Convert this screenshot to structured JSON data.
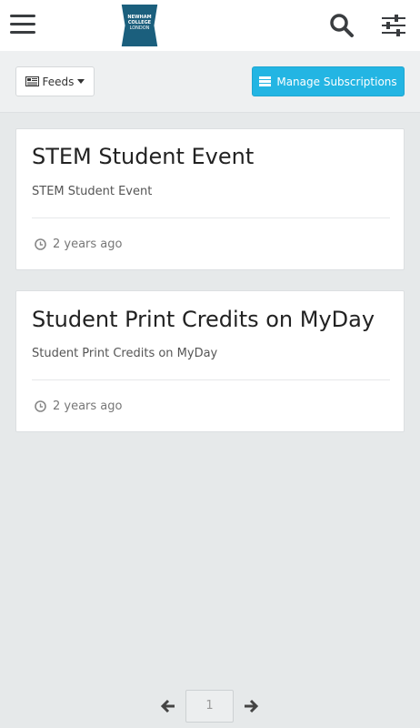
{
  "header": {
    "logo_lines": [
      "NEWHAM",
      "COLLEGE",
      "LONDON"
    ]
  },
  "toolbar": {
    "feeds_label": "Feeds",
    "manage_label": "Manage Subscriptions"
  },
  "feed": {
    "items": [
      {
        "title": "STEM Student Event",
        "description": "STEM Student Event",
        "time": "2 years ago"
      },
      {
        "title": "Student Print Credits on MyDay",
        "description": "Student Print Credits on MyDay",
        "time": "2 years ago"
      }
    ]
  },
  "pagination": {
    "current_page": "1"
  },
  "colors": {
    "accent": "#23b5e3",
    "logo": "#1b5f7d",
    "background": "#e6e9ea"
  },
  "icons": [
    "menu-icon",
    "search-icon",
    "filter-sliders-icon",
    "newspaper-icon",
    "caret-down-icon",
    "list-icon",
    "clock-icon",
    "arrow-left-icon",
    "arrow-right-icon"
  ]
}
